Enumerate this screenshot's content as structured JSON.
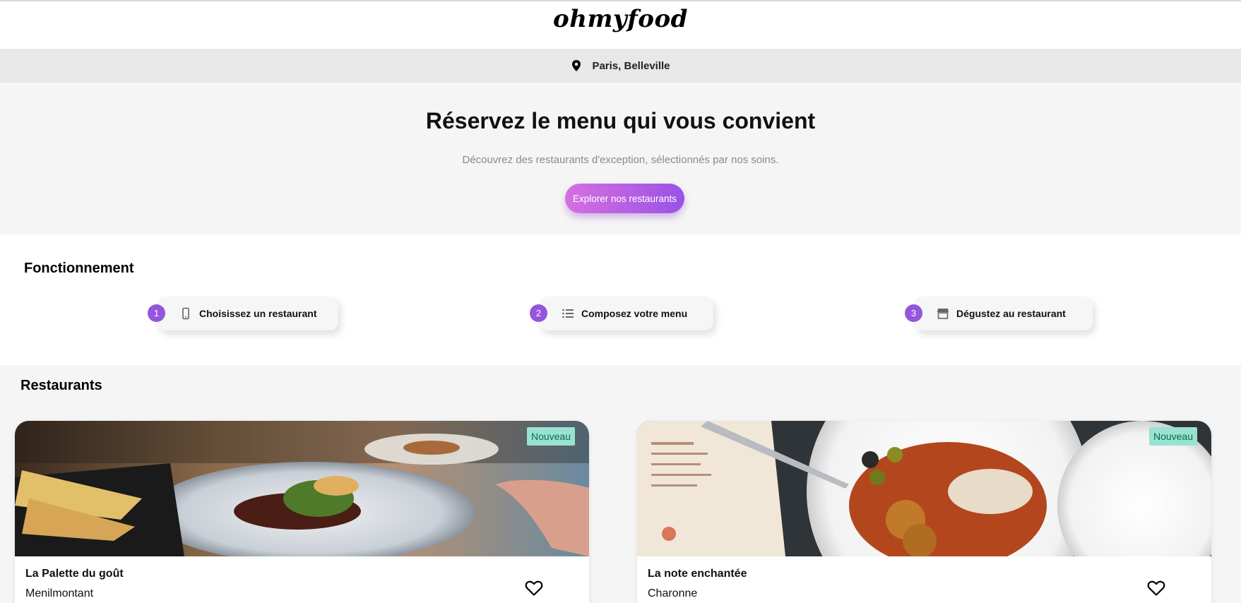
{
  "header": {
    "logo": "ohmyfood"
  },
  "location": {
    "icon": "map-pin-icon",
    "label": "Paris, Belleville"
  },
  "hero": {
    "title": "Réservez le menu qui vous convient",
    "subtitle": "Découvrez des restaurants d'exception, sélectionnés par nos soins.",
    "cta_label": "Explorer nos restaurants"
  },
  "how": {
    "title": "Fonctionnement",
    "steps": [
      {
        "num": "1",
        "icon": "phone-icon",
        "label": "Choisissez un restaurant"
      },
      {
        "num": "2",
        "icon": "list-icon",
        "label": "Composez votre menu"
      },
      {
        "num": "3",
        "icon": "store-icon",
        "label": "Dégustez au restaurant"
      }
    ]
  },
  "restaurants": {
    "title": "Restaurants",
    "items": [
      {
        "name": "La Palette du goût",
        "area": "Menilmontant",
        "badge": "Nouveau"
      },
      {
        "name": "La note enchantée",
        "area": "Charonne",
        "badge": "Nouveau"
      }
    ]
  },
  "colors": {
    "accent_purple": "#9356dc",
    "cta_start": "#d66fe0",
    "cta_end": "#9a52e6",
    "badge_bg": "#99e2d0"
  }
}
